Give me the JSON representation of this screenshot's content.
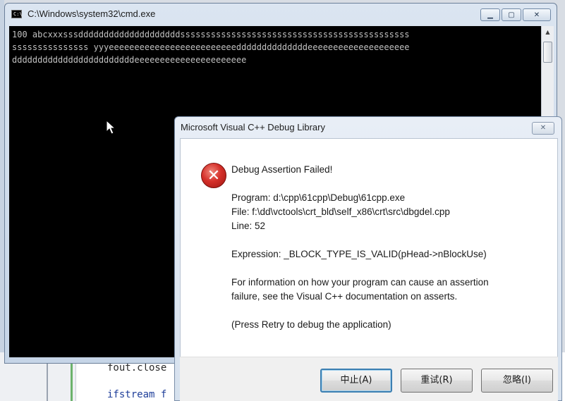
{
  "ide": {
    "lines": [
      "fout.close",
      "ifstream f"
    ]
  },
  "cmd": {
    "title": "C:\\Windows\\system32\\cmd.exe",
    "icon_text": "C:\\",
    "buttons": {
      "minimize": "▁",
      "maximize": "▢",
      "close": "✕"
    },
    "output_lines": [
      "100 abcxxxsssddddddddddddddddddddsssssssssssssssssssssssssssssssssssssssssssss",
      "sssssssssssssss yyyeeeeeeeeeeeeeeeeeeeeeeeeeddddddddddddddeeeeeeeeeeeeeeeeeeee",
      "ddddddddddddddddddddddddeeeeeeeeeeeeeeeeeeeeee"
    ]
  },
  "dialog": {
    "title": "Microsoft Visual C++ Debug Library",
    "close_glyph": "✕",
    "icon": "error-icon",
    "icon_glyph": "✕",
    "heading": "Debug Assertion Failed!",
    "program": "Program: d:\\cpp\\61cpp\\Debug\\61cpp.exe",
    "file": "File: f:\\dd\\vctools\\crt_bld\\self_x86\\crt\\src\\dbgdel.cpp",
    "line": "Line: 52",
    "expression": "Expression: _BLOCK_TYPE_IS_VALID(pHead->nBlockUse)",
    "info_line1": "For information on how your program can cause an assertion",
    "info_line2": "failure, see the Visual C++ documentation on asserts.",
    "retry_hint": "(Press Retry to debug the application)",
    "buttons": {
      "abort": "中止(A)",
      "retry": "重试(R)",
      "ignore": "忽略(I)"
    }
  },
  "colors": {
    "console_bg": "#000000",
    "console_text": "#c0c0c0",
    "error_red": "#d5302a",
    "default_button_border": "#3c7fb1"
  }
}
